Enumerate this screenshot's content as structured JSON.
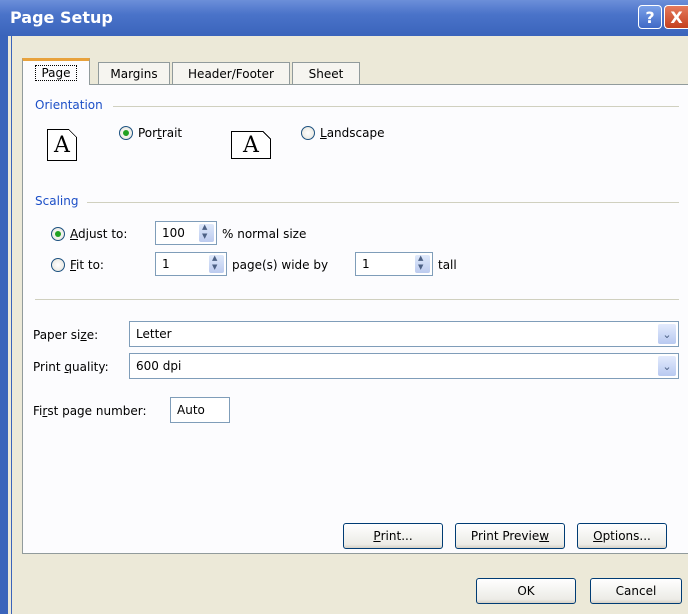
{
  "window": {
    "title": "Page Setup"
  },
  "titlebar": {
    "help_glyph": "?",
    "close_glyph": "X"
  },
  "tabs": [
    {
      "label": "Page"
    },
    {
      "label": "Margins"
    },
    {
      "label": "Header/Footer"
    },
    {
      "label": "Sheet"
    }
  ],
  "orientation": {
    "group_label": "Orientation",
    "icon_glyph": "A",
    "portrait_pre": "Por",
    "portrait_key": "t",
    "portrait_post": "rait",
    "landscape_key": "L",
    "landscape_post": "andscape",
    "selected": "portrait"
  },
  "scaling": {
    "group_label": "Scaling",
    "adjust_key": "A",
    "adjust_post": "djust to:",
    "adjust_value": "100",
    "adjust_suffix": "% normal size",
    "fit_key": "F",
    "fit_post": "it to:",
    "fit_wide_value": "1",
    "fit_wide_suffix": "page(s) wide by",
    "fit_tall_value": "1",
    "fit_tall_suffix": "tall",
    "selected": "adjust"
  },
  "paper_size": {
    "label_pre": "Paper si",
    "label_key": "z",
    "label_post": "e:",
    "value": "Letter"
  },
  "print_quality": {
    "label_pre": "Print ",
    "label_key": "q",
    "label_post": "uality:",
    "value": "600 dpi"
  },
  "first_page": {
    "label_pre": "Fi",
    "label_key": "r",
    "label_post": "st page number:",
    "value": "Auto"
  },
  "buttons": {
    "print_key": "P",
    "print_post": "rint...",
    "preview_pre": "Print Previe",
    "preview_key": "w",
    "options_key": "O",
    "options_post": "ptions...",
    "ok": "OK",
    "cancel": "Cancel"
  },
  "colors": {
    "title_bar": "#3a64bb",
    "group_label": "#1c4fc7",
    "dialog_bg": "#ece9d8",
    "radio_dot": "#21a121"
  }
}
